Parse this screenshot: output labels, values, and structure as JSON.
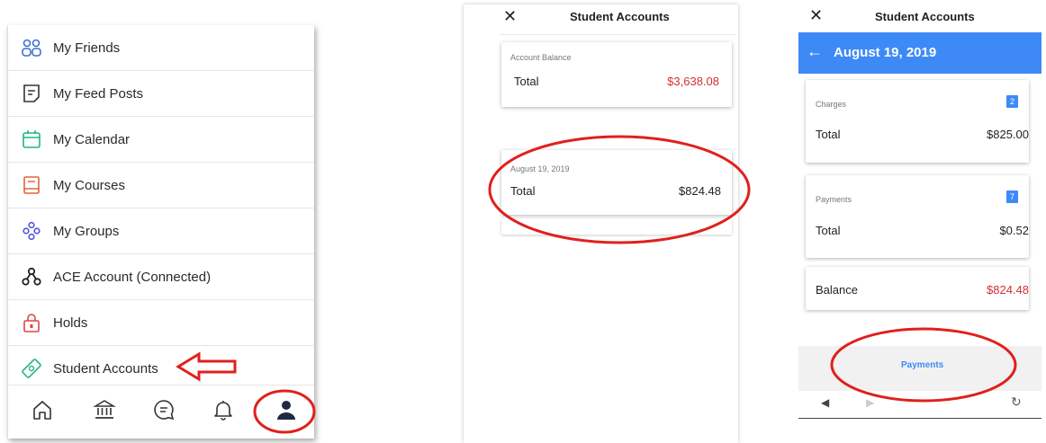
{
  "left_menu": {
    "items": [
      {
        "label": "My Friends",
        "icon": "friends-icon"
      },
      {
        "label": "My Feed Posts",
        "icon": "feed-posts-icon"
      },
      {
        "label": "My Calendar",
        "icon": "calendar-icon"
      },
      {
        "label": "My Courses",
        "icon": "courses-icon"
      },
      {
        "label": "My Groups",
        "icon": "groups-icon"
      },
      {
        "label": "ACE Account (Connected)",
        "icon": "ace-account-icon"
      },
      {
        "label": "Holds",
        "icon": "lock-icon"
      },
      {
        "label": "Student Accounts",
        "icon": "money-icon"
      }
    ],
    "bottom_nav": [
      "home-icon",
      "bank-icon",
      "chat-icon",
      "bell-icon",
      "profile-icon"
    ]
  },
  "middle_screen": {
    "title": "Student Accounts",
    "balance_card": {
      "label": "Account Balance",
      "total_label": "Total",
      "amount": "$3,638.08"
    },
    "date_card": {
      "date": "August 19, 2019",
      "total_label": "Total",
      "amount": "$824.48"
    }
  },
  "right_screen": {
    "title": "Student Accounts",
    "date_header": "August 19, 2019",
    "charges": {
      "label": "Charges",
      "badge": "2",
      "total_label": "Total",
      "amount": "$825.00"
    },
    "payments": {
      "label": "Payments",
      "badge": "7",
      "total_label": "Total",
      "amount": "$0.52"
    },
    "balance": {
      "label": "Balance",
      "amount": "$824.48"
    },
    "payments_button": "Payments"
  },
  "colors": {
    "accent_blue": "#3d8af7",
    "alert_red": "#d32f2f",
    "annotation_red": "#e0201c"
  }
}
